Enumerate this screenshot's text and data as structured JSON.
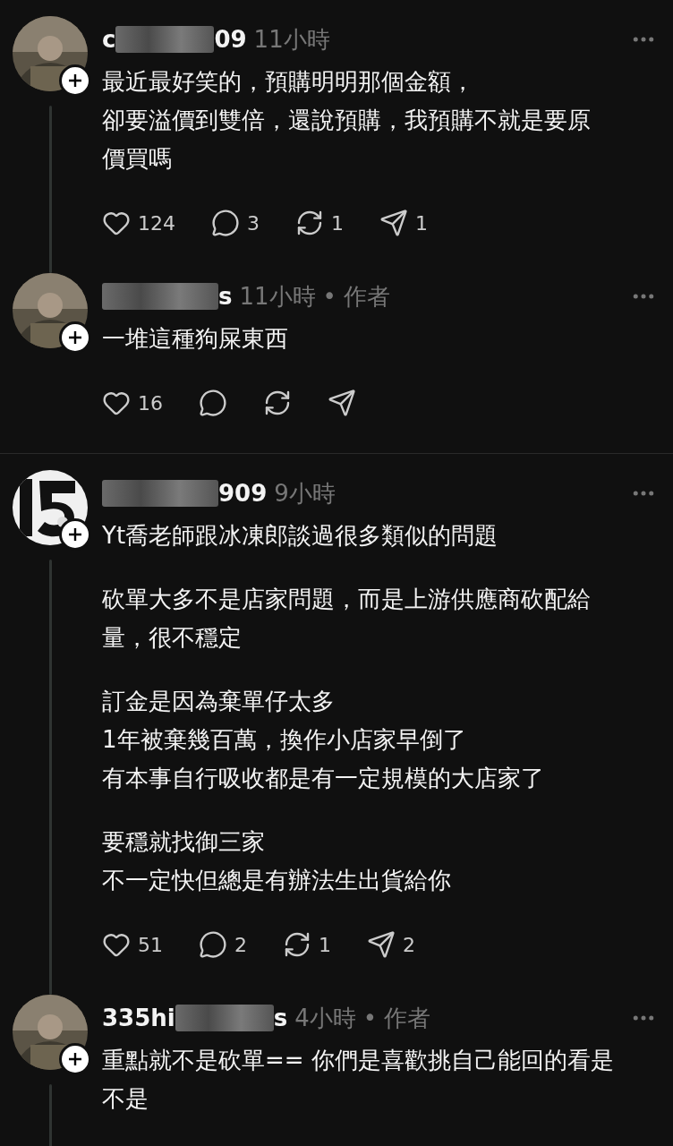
{
  "threads": [
    {
      "posts": [
        {
          "avatar": {
            "kind": "person"
          },
          "name_prefix": "c",
          "name_suffix": "09",
          "time": "11小時",
          "thread_line": true,
          "paragraphs": [
            [
              "最近最好笑的，預購明明那個金額，",
              "卻要溢價到雙倍，還說預購，我預購不就是要原",
              "價買嗎"
            ]
          ],
          "stats": {
            "likes": "124",
            "replies": "3",
            "reposts": "1",
            "shares": "1"
          }
        },
        {
          "avatar": {
            "kind": "person"
          },
          "name_suffix": "s",
          "time": "11小時",
          "separator": "•",
          "author_tag": "作者",
          "thread_line": false,
          "paragraphs": [
            [
              "一堆這種狗屎東西"
            ]
          ],
          "stats": {
            "likes": "16"
          }
        }
      ]
    },
    {
      "posts": [
        {
          "avatar": {
            "kind": "logo"
          },
          "name_suffix": "909",
          "time": "9小時",
          "thread_line": true,
          "paragraphs": [
            [
              "Yt喬老師跟冰凍郎談過很多類似的問題"
            ],
            [
              "砍單大多不是店家問題，而是上游供應商砍配給",
              "量，很不穩定"
            ],
            [
              "訂金是因為棄單仔太多",
              "1年被棄幾百萬，換作小店家早倒了",
              "有本事自行吸收都是有一定規模的大店家了"
            ],
            [
              "要穩就找御三家",
              "不一定快但總是有辦法生出貨給你"
            ]
          ],
          "stats": {
            "likes": "51",
            "replies": "2",
            "reposts": "1",
            "shares": "2"
          }
        },
        {
          "avatar": {
            "kind": "person"
          },
          "name_prefix": "335hi",
          "name_suffix": "s",
          "time": "4小時",
          "separator": "•",
          "author_tag": "作者",
          "thread_line": true,
          "paragraphs": [
            [
              "重點就不是砍單== 你們是喜歡挑自己能回的看是",
              "不是"
            ]
          ]
        }
      ]
    }
  ]
}
